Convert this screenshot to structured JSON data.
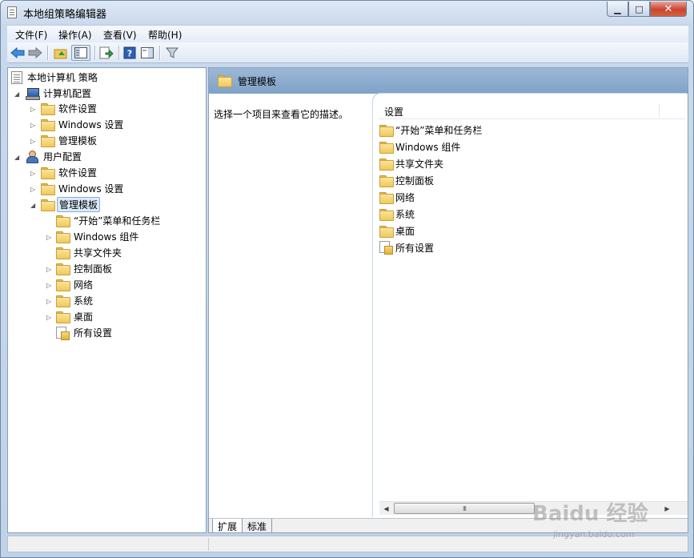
{
  "window": {
    "title": "本地组策略编辑器",
    "close_glyph": "✕",
    "maximize_glyph": "□",
    "minimize_glyph": "▁"
  },
  "menubar": {
    "items": [
      "文件(F)",
      "操作(A)",
      "查看(V)",
      "帮助(H)"
    ]
  },
  "toolbar": {
    "icons": [
      "back-arrow-icon",
      "forward-arrow-icon",
      "up-folder-icon",
      "show-hide-tree-icon",
      "export-list-icon",
      "help-icon",
      "show-hide-action-pane-icon",
      "filter-icon"
    ]
  },
  "tree": {
    "root": "本地计算机 策略",
    "computer_config": {
      "label": "计算机配置",
      "children": [
        "软件设置",
        "Windows 设置",
        "管理模板"
      ]
    },
    "user_config": {
      "label": "用户配置",
      "children": [
        "软件设置",
        "Windows 设置"
      ],
      "admin_templates": {
        "label": "管理模板",
        "children": [
          "“开始”菜单和任务栏",
          "Windows 组件",
          "共享文件夹",
          "控制面板",
          "网络",
          "系统",
          "桌面",
          "所有设置"
        ]
      }
    }
  },
  "right": {
    "header_title": "管理模板",
    "description": "选择一个项目来查看它的描述。",
    "column_header": "设置",
    "items": [
      "“开始”菜单和任务栏",
      "Windows 组件",
      "共享文件夹",
      "控制面板",
      "网络",
      "系统",
      "桌面",
      "所有设置"
    ],
    "tabs": [
      "扩展",
      "标准"
    ],
    "scroll_thumb_glyph": "III"
  },
  "watermark": {
    "brand": "Baidu 经验",
    "url": "jingyan.baidu.com"
  },
  "colors": {
    "header_blue": "#8fadd0",
    "selection": "#dbeaf9",
    "folder": "#f1c95a"
  }
}
